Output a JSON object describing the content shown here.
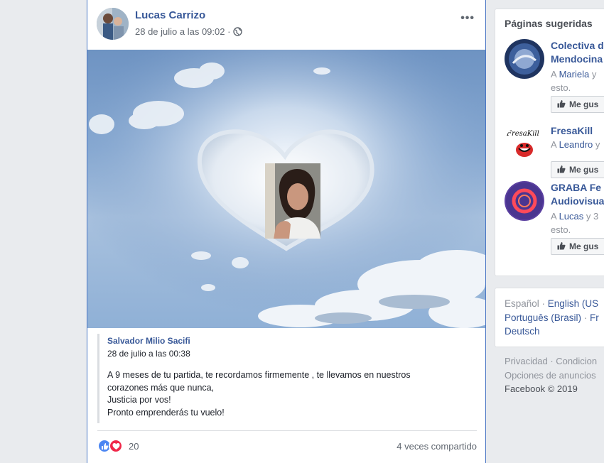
{
  "post": {
    "author": "Lucas Carrizo",
    "date": "28 de julio a las 09:02 ·",
    "more_icon": "more-icon",
    "photo_alt": "",
    "shared": {
      "author": "Salvador Milio Sacifi",
      "date": "28 de julio a las 00:38",
      "lines": [
        "A 9 meses de tu partida, te recordamos firmemente , te llevamos en nuestros",
        "corazones más que nunca,",
        "Justicia por vos!",
        "Pronto emprenderás tu vuelo!"
      ]
    },
    "reactions_count": "20",
    "shares": "4 veces compartido"
  },
  "sidebar": {
    "title": "Páginas sugeridas",
    "items": [
      {
        "name_line1": "Colectiva d",
        "name_line2": "Mendocina",
        "desc_prefix": "A ",
        "desc_name": "Mariela",
        "desc_rest": " y",
        "desc_line2": "esto.",
        "button": "Me gus"
      },
      {
        "name_line1": "FresaKill",
        "name_line2": "",
        "desc_prefix": "A ",
        "desc_name": "Leandro",
        "desc_rest": " y",
        "desc_line2": "",
        "button": "Me gus"
      },
      {
        "name_line1": "GRABA Fe",
        "name_line2": "Audiovisua",
        "desc_prefix": "A ",
        "desc_name": "Lucas",
        "desc_rest": " y 3",
        "desc_line2": "esto.",
        "button": "Me gus"
      }
    ],
    "languages": {
      "current": "Español",
      "sep": " · ",
      "english": "English (US",
      "portuguese": "Português (Brasil)",
      "fr": "Fr",
      "deutsch": "Deutsch"
    },
    "legal": {
      "privacy": "Privacidad",
      "sep": " · ",
      "conditions": "Condicion",
      "ads": "Opciones de anuncios",
      "copyright": "Facebook © 2019"
    }
  },
  "colors": {
    "link": "#385898",
    "accent_border": "#4a76c4",
    "like": "#4b86f2",
    "love": "#f0284a"
  }
}
